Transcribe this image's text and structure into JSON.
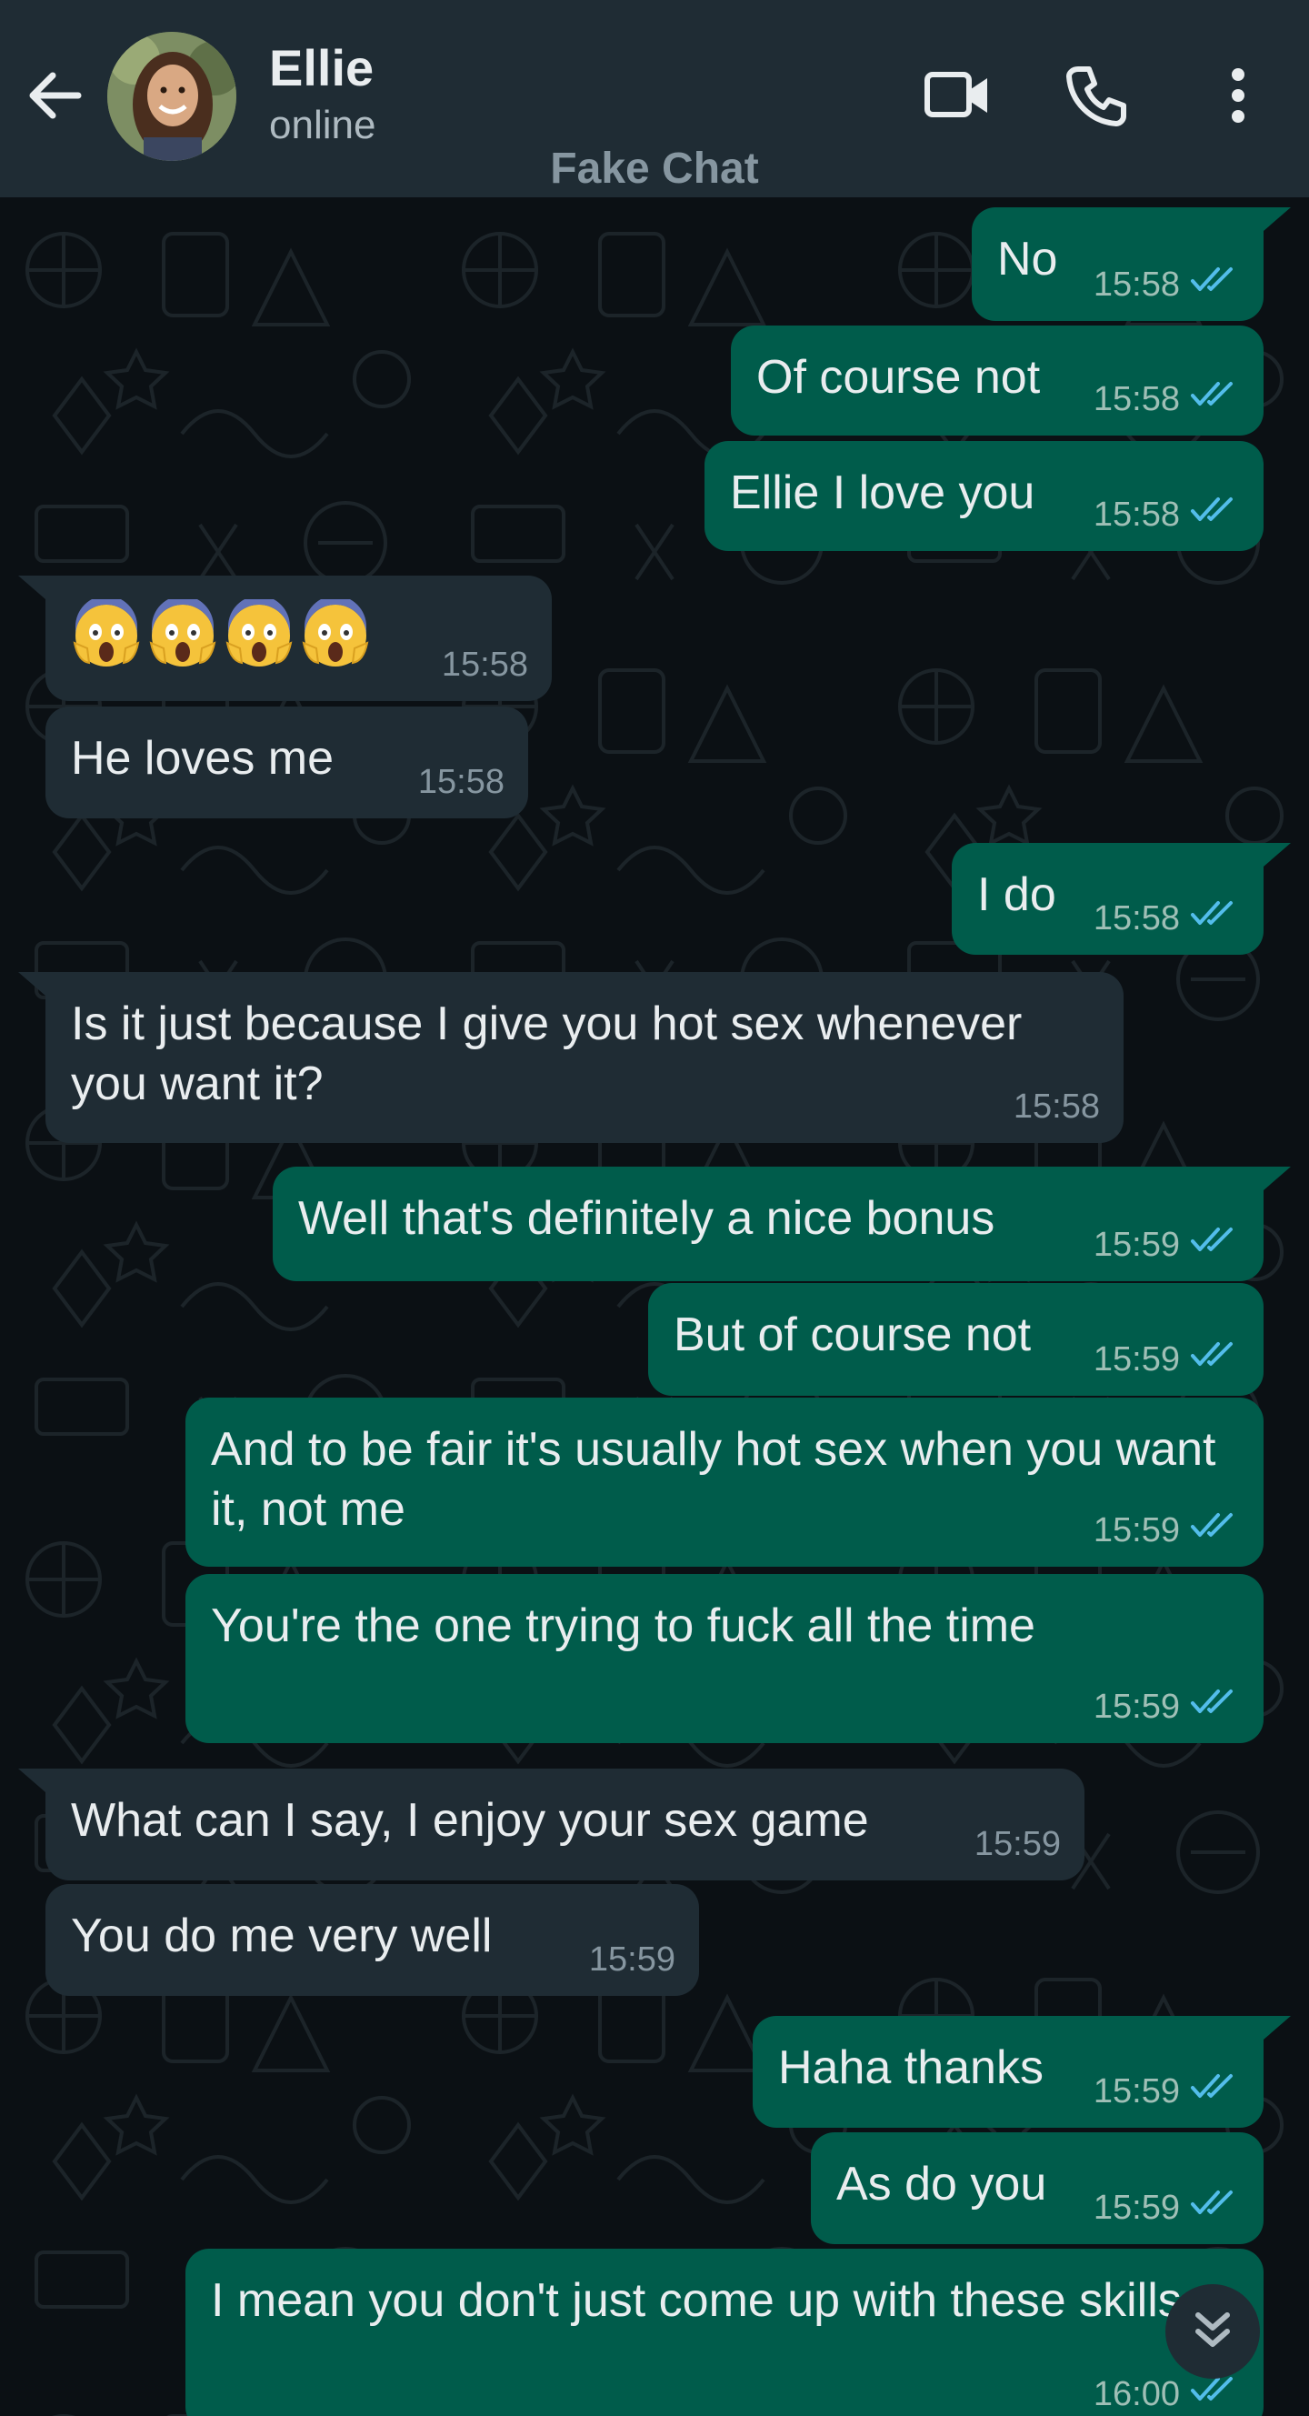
{
  "header": {
    "contact_name": "Ellie",
    "status": "online",
    "watermark": "Fake Chat",
    "icons": [
      "back-arrow-icon",
      "video-call-icon",
      "phone-icon",
      "more-options-icon"
    ]
  },
  "colors": {
    "header_bg": "#1f2c34",
    "chat_bg": "#0b1014",
    "outgoing_bubble": "#005c4b",
    "incoming_bubble": "#1f2c34",
    "read_tick": "#53bdeb"
  },
  "messages": [
    {
      "dir": "out",
      "text": "No",
      "time": "15:58",
      "read": true
    },
    {
      "dir": "out",
      "text": "Of course not",
      "time": "15:58",
      "read": true
    },
    {
      "dir": "out",
      "text": "Ellie I love you",
      "time": "15:58",
      "read": true
    },
    {
      "dir": "in",
      "text": "😱😱😱😱",
      "time": "15:58"
    },
    {
      "dir": "in",
      "text": "He loves me",
      "time": "15:58"
    },
    {
      "dir": "out",
      "text": "I do",
      "time": "15:58",
      "read": true
    },
    {
      "dir": "in",
      "text": "Is it just because I give you hot sex whenever you want it?",
      "time": "15:58"
    },
    {
      "dir": "out",
      "text": "Well that's definitely a nice bonus",
      "time": "15:59",
      "read": true
    },
    {
      "dir": "out",
      "text": "But of course not",
      "time": "15:59",
      "read": true
    },
    {
      "dir": "out",
      "text": "And to be fair it's usually hot sex when you want it, not me",
      "time": "15:59",
      "read": true
    },
    {
      "dir": "out",
      "text": "You're the one trying to fuck all the time",
      "time": "15:59",
      "read": true
    },
    {
      "dir": "in",
      "text": "What can I say, I enjoy your sex game",
      "time": "15:59"
    },
    {
      "dir": "in",
      "text": "You do me very well",
      "time": "15:59"
    },
    {
      "dir": "out",
      "text": "Haha thanks",
      "time": "15:59",
      "read": true
    },
    {
      "dir": "out",
      "text": "As do you",
      "time": "15:59",
      "read": true
    },
    {
      "dir": "out",
      "text": "I mean you don't just come up with these skills",
      "time": "16:00",
      "read": true
    }
  ]
}
